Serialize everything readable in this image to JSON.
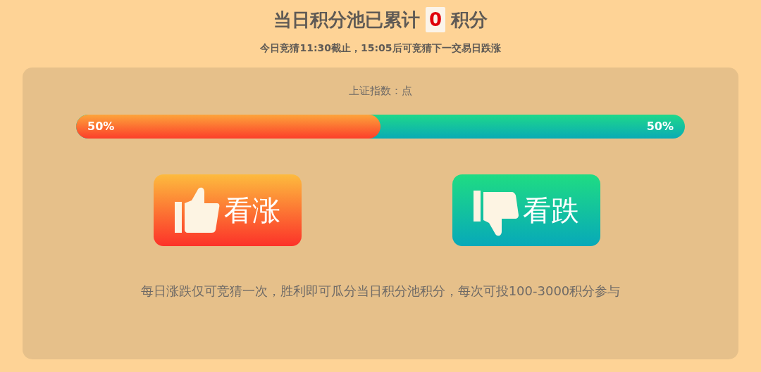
{
  "header": {
    "title_prefix": "当日积分池已累计",
    "pool_value": "0",
    "title_suffix": "积分",
    "subtitle": "今日竞猜11:30截止，15:05后可竞猜下一交易日跌涨"
  },
  "panel": {
    "index_label": "上证指数：点",
    "bar": {
      "level": 0.5,
      "up_label": "50%",
      "down_label": "50%"
    },
    "buttons": [
      {
        "kind": "up",
        "label": "看涨"
      },
      {
        "kind": "down",
        "label": "看跌"
      }
    ],
    "note": "每日涨跌仅可竞猜一次，胜利即可瓜分当日积分池积分，每次可投100-3000积分参与"
  }
}
